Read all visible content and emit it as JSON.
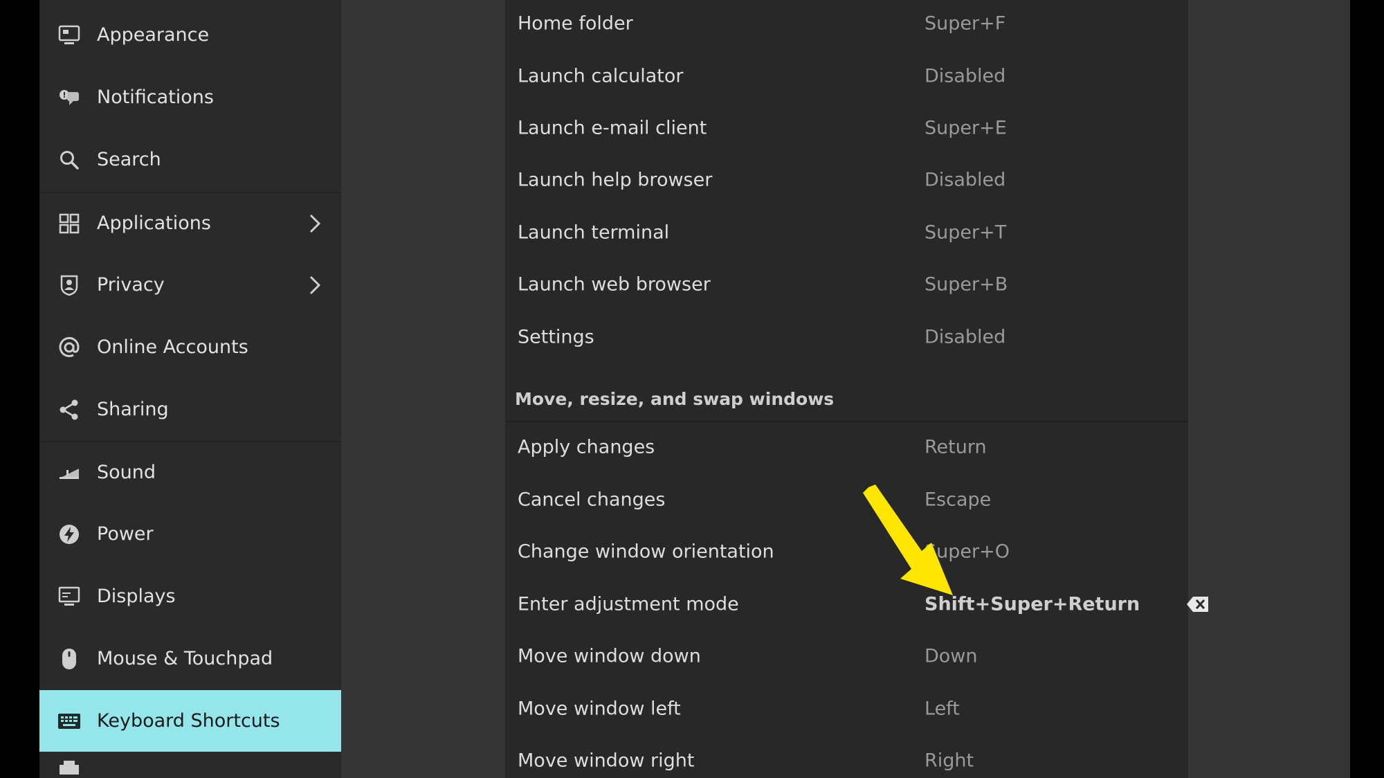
{
  "sidebar": {
    "items": [
      {
        "label": "Appearance",
        "icon": "appearance-icon"
      },
      {
        "label": "Notifications",
        "icon": "notifications-icon"
      },
      {
        "label": "Search",
        "icon": "search-icon"
      },
      {
        "label": "Applications",
        "icon": "applications-icon"
      },
      {
        "label": "Privacy",
        "icon": "privacy-icon"
      },
      {
        "label": "Online Accounts",
        "icon": "at-icon"
      },
      {
        "label": "Sharing",
        "icon": "share-icon"
      },
      {
        "label": "Sound",
        "icon": "sound-icon"
      },
      {
        "label": "Power",
        "icon": "power-icon"
      },
      {
        "label": "Displays",
        "icon": "display-icon"
      },
      {
        "label": "Mouse & Touchpad",
        "icon": "mouse-icon"
      },
      {
        "label": "Keyboard Shortcuts",
        "icon": "keyboard-icon"
      }
    ],
    "active": "Keyboard Shortcuts"
  },
  "shortcuts": {
    "launchers": [
      {
        "name": "Home folder",
        "accel": "Super+F"
      },
      {
        "name": "Launch calculator",
        "accel": "Disabled"
      },
      {
        "name": "Launch e-mail client",
        "accel": "Super+E"
      },
      {
        "name": "Launch help browser",
        "accel": "Disabled"
      },
      {
        "name": "Launch terminal",
        "accel": "Super+T"
      },
      {
        "name": "Launch web browser",
        "accel": "Super+B"
      },
      {
        "name": "Settings",
        "accel": "Disabled"
      }
    ],
    "section_title": "Move, resize, and swap windows",
    "windows": [
      {
        "name": "Apply changes",
        "accel": "Return"
      },
      {
        "name": "Cancel changes",
        "accel": "Escape"
      },
      {
        "name": "Change window orientation",
        "accel": "Super+O"
      },
      {
        "name": "Enter adjustment mode",
        "accel": "Shift+Super+Return"
      },
      {
        "name": "Move window down",
        "accel": "Down"
      },
      {
        "name": "Move window left",
        "accel": "Left"
      },
      {
        "name": "Move window right",
        "accel": "Right"
      }
    ]
  },
  "colors": {
    "active_accent": "#94e6ea",
    "annotation_arrow": "#ffe600"
  }
}
